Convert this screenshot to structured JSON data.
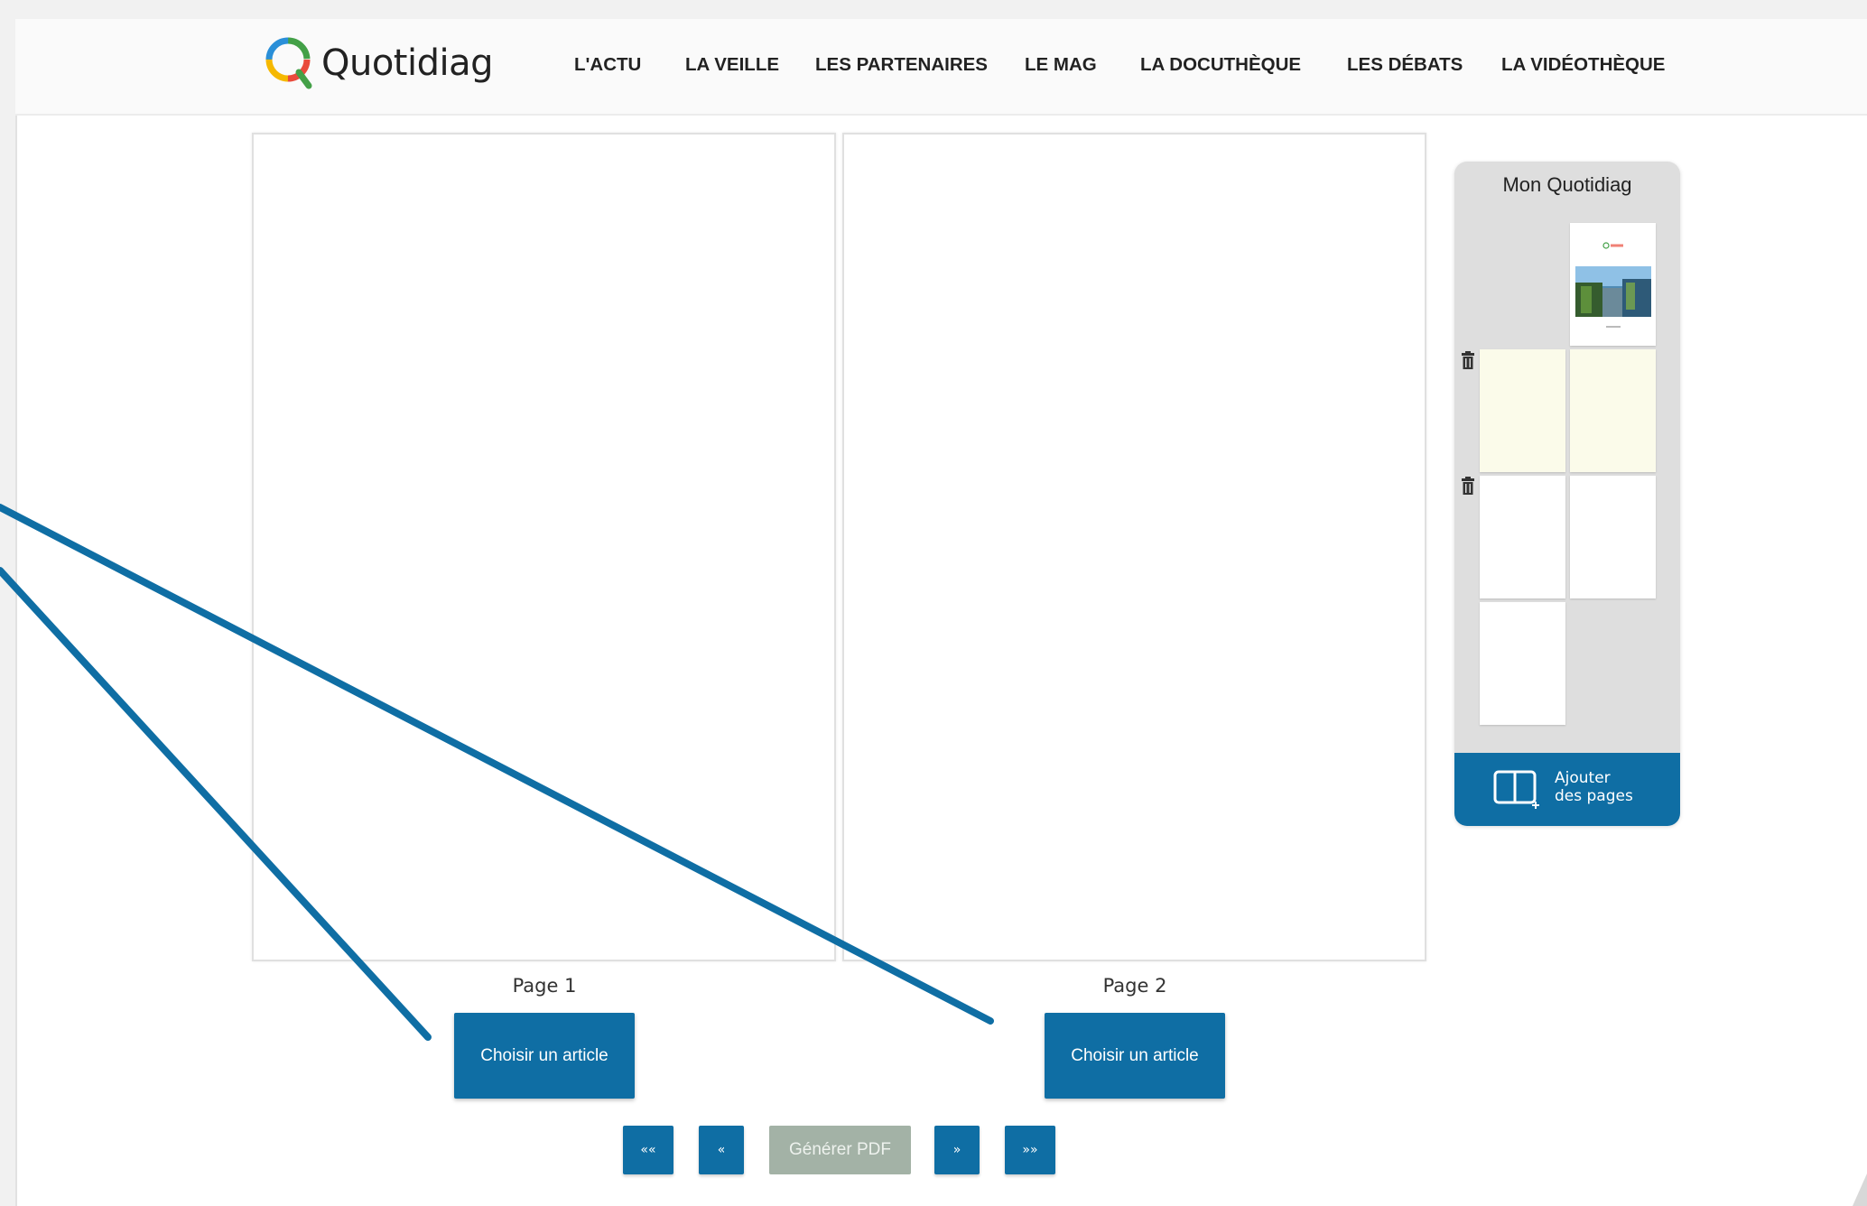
{
  "header": {
    "logo_text": "Quotidiag",
    "nav": [
      "L'ACTU",
      "LA VEILLE",
      "LES PARTENAIRES",
      "LE MAG",
      "LA DOCUTHÈQUE",
      "LES DÉBATS",
      "LA VIDÉOTHÈQUE"
    ]
  },
  "pages": [
    {
      "label": "Page 1",
      "button": "Choisir un article"
    },
    {
      "label": "Page 2",
      "button": "Choisir un article"
    }
  ],
  "pager": {
    "first": "««",
    "prev": "«",
    "generate": "Générer PDF",
    "next": "»",
    "last": "»»"
  },
  "sidebar": {
    "title": "Mon Quotidiag",
    "add_label_line1": "Ajouter",
    "add_label_line2": "des pages",
    "cover_logo": "Quotidiag"
  },
  "colors": {
    "primary": "#0f6ea4",
    "pdf_button": "#a3b2a6",
    "sidebar_bg": "#dedede",
    "annotation_line": "#0f6ea4"
  }
}
